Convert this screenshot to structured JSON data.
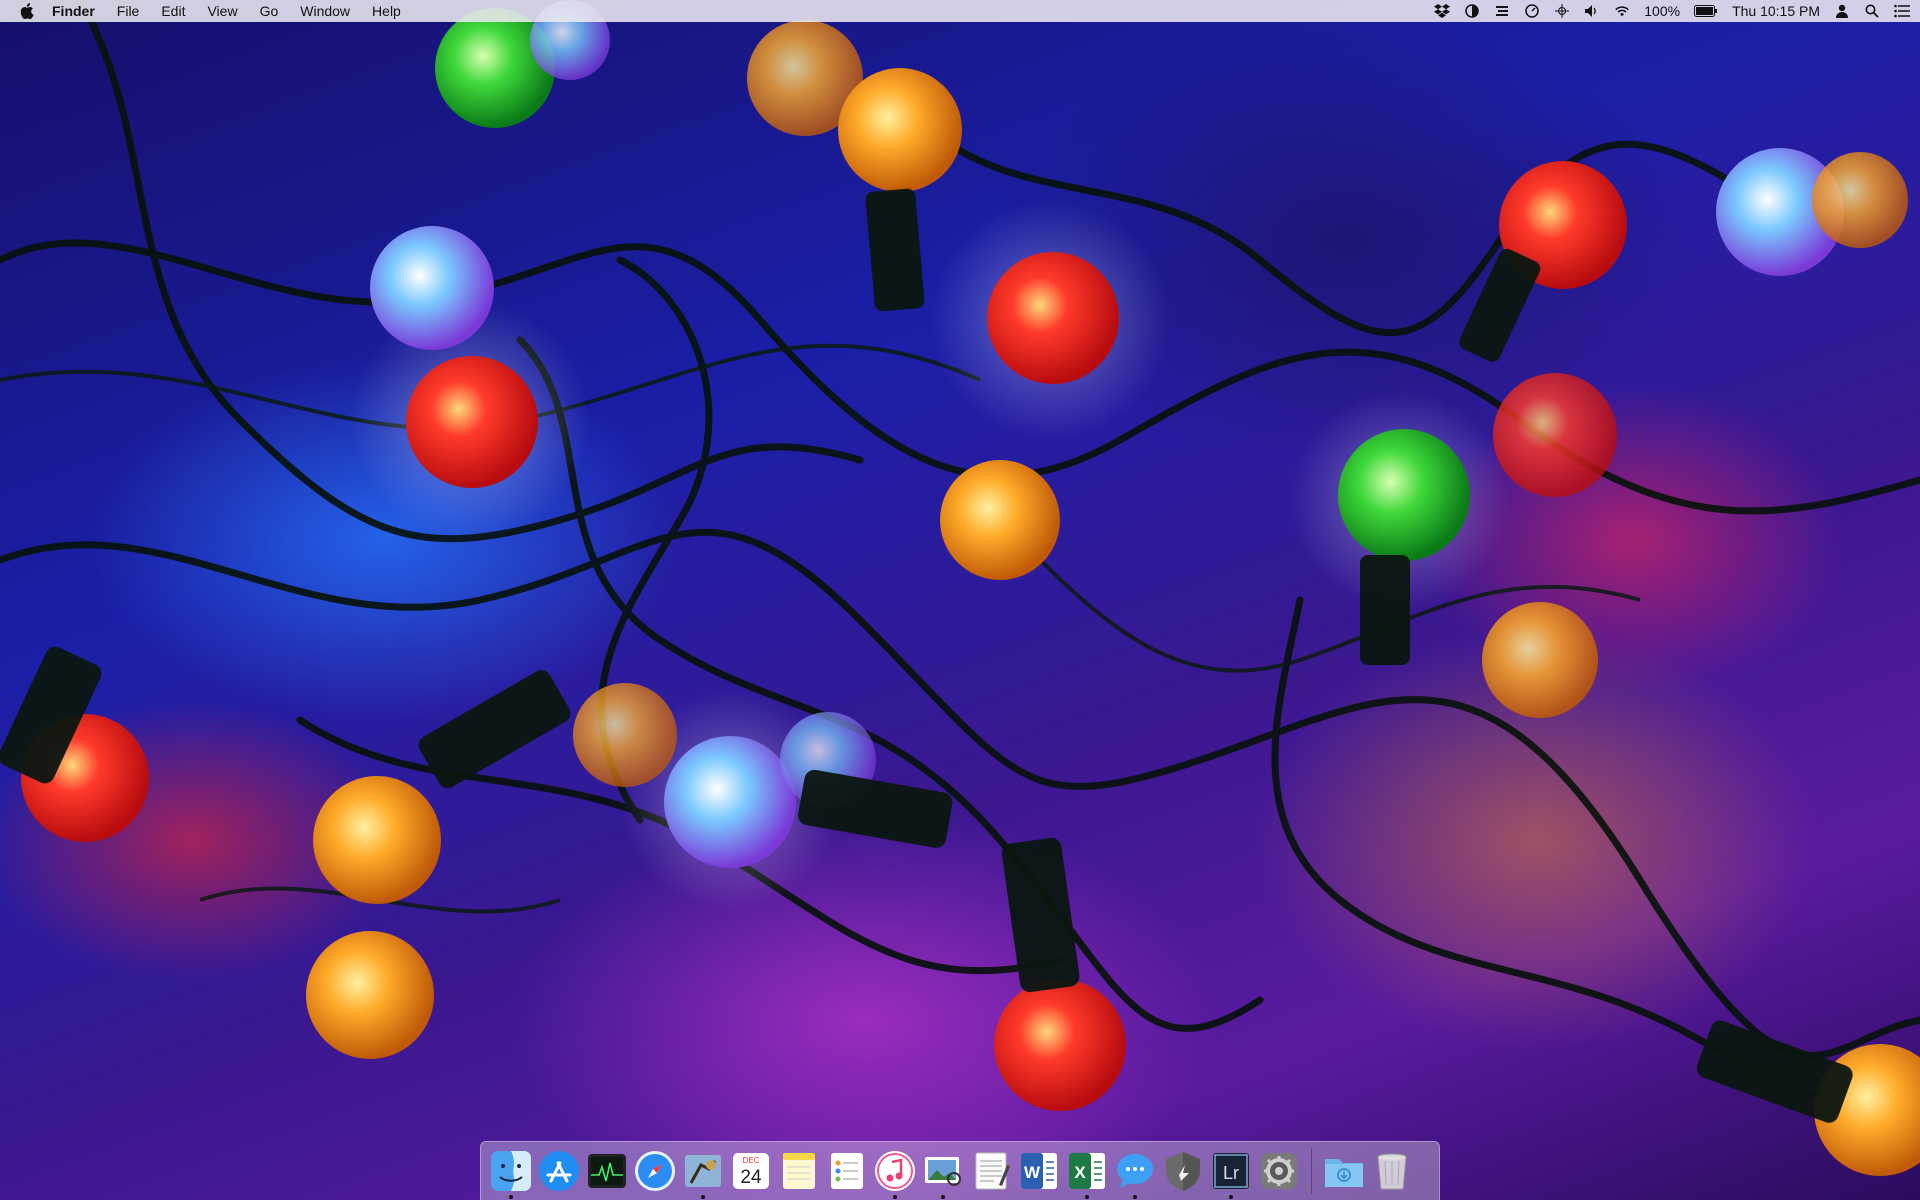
{
  "menubar": {
    "app_name": "Finder",
    "menus": [
      "File",
      "Edit",
      "View",
      "Go",
      "Window",
      "Help"
    ],
    "battery": "100%",
    "clock": "Thu 10:15 PM",
    "status_icons": [
      "dropbox-icon",
      "contrast-icon",
      "stack-icon",
      "speedometer-icon",
      "crosshair-icon",
      "volume-icon",
      "wifi-icon",
      "battery-icon",
      "user-icon",
      "search-icon",
      "notification-list-icon"
    ]
  },
  "dock": {
    "calendar": {
      "month": "DEC",
      "day": "24"
    },
    "lightroom_label": "Lr",
    "word_label": "W",
    "excel_label": "X",
    "items": [
      "finder-icon",
      "app-store-icon",
      "activity-monitor-icon",
      "safari-icon",
      "mail-icon",
      "calendar-icon",
      "notes-icon",
      "reminders-icon",
      "itunes-icon",
      "preview-icon",
      "textedit-icon",
      "word-icon",
      "excel-icon",
      "messages-icon",
      "codeshield-icon",
      "lightroom-icon",
      "system-preferences-icon",
      "downloads-folder-icon",
      "trash-icon"
    ]
  },
  "colors": {
    "menubar_bg": "#ece8f0",
    "dock_bg": "#e6e1eb"
  }
}
